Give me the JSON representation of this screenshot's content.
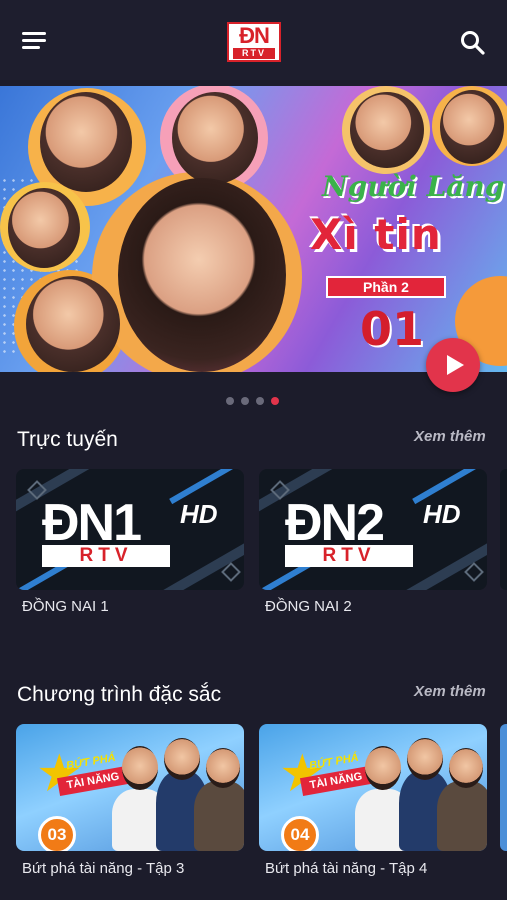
{
  "app": {
    "logo_dn": "ĐN",
    "logo_rtv": "RTV",
    "menu_icon": "hamburger-menu-icon",
    "search_icon": "search-icon",
    "accent_color": "#e2344b",
    "background_color": "#1c1c2b"
  },
  "banner": {
    "title_line1": "Người Lăng",
    "title_line2": "Xì tin",
    "part_label": "Phần 2",
    "episode": "01",
    "play_icon": "play-icon",
    "pager_count": 4,
    "pager_active_index": 3
  },
  "live": {
    "title": "Trực tuyến",
    "see_more": "Xem thêm",
    "channels": [
      {
        "logo_prefix": "ĐN",
        "logo_number": "1",
        "logo_hd": "HD",
        "logo_rtv": "RTV",
        "name": "ĐỒNG NAI 1"
      },
      {
        "logo_prefix": "ĐN",
        "logo_number": "2",
        "logo_hd": "HD",
        "logo_rtv": "RTV",
        "name": "ĐỒNG NAI 2"
      }
    ]
  },
  "featured": {
    "title": "Chương trình đặc sắc",
    "see_more": "Xem thêm",
    "shows": [
      {
        "brand_line1": "BỨT PHÁ",
        "brand_line2": "TÀI NĂNG",
        "episode_badge": "03",
        "name": "Bứt phá tài năng - Tập 3"
      },
      {
        "brand_line1": "BỨT PHÁ",
        "brand_line2": "TÀI NĂNG",
        "episode_badge": "04",
        "name": "Bứt phá tài năng - Tập 4"
      }
    ]
  }
}
